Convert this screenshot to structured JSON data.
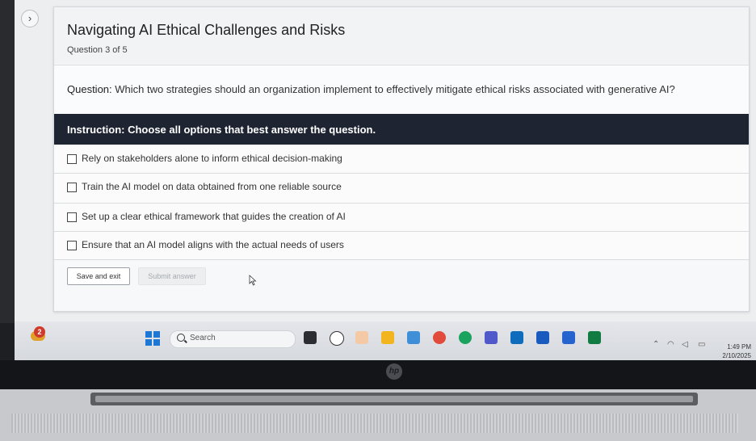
{
  "page": {
    "title": "Navigating AI Ethical Challenges and Risks",
    "progress": "Question 3 of 5"
  },
  "question": {
    "label": "Question:",
    "text": "Which two strategies should an organization implement to effectively mitigate ethical risks associated with generative AI?"
  },
  "instruction": "Instruction: Choose all options that best answer the question.",
  "options": [
    {
      "label": "Rely on stakeholders alone to inform ethical decision-making",
      "checked": false
    },
    {
      "label": "Train the AI model on data obtained from one reliable source",
      "checked": false
    },
    {
      "label": "Set up a clear ethical framework that guides the creation of AI",
      "checked": false
    },
    {
      "label": "Ensure that an AI model aligns with the actual needs of users",
      "checked": false
    }
  ],
  "actions": {
    "save_label": "Save and exit",
    "submit_label": "Submit answer",
    "submit_disabled": true
  },
  "taskbar": {
    "notification_count": "2",
    "search_placeholder": "Search",
    "time": "1:49 PM",
    "date": "2/10/2025",
    "icons": [
      "start-icon",
      "search-icon",
      "task-view-icon",
      "copilot-icon",
      "snipping-tool-icon",
      "file-explorer-icon",
      "notepad-icon",
      "chrome-icon",
      "edge-icon",
      "teams-icon",
      "outlook-icon",
      "word-icon",
      "tasks-icon",
      "excel-icon"
    ]
  },
  "colors": {
    "instruction_bar": "#1f2433",
    "accent_blue": "#1c78d4",
    "badge_red": "#d03a2b"
  },
  "brand": "hp"
}
